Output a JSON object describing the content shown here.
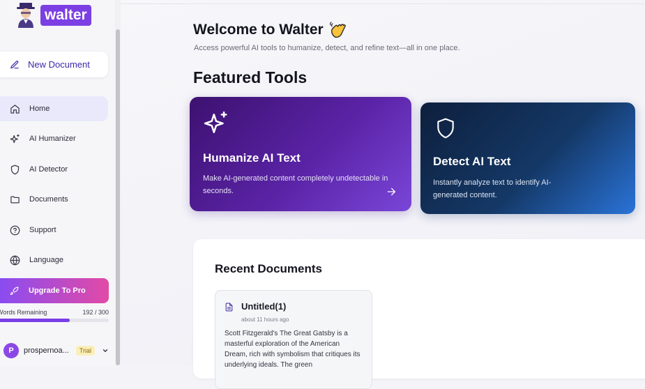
{
  "app": {
    "name": "walter"
  },
  "sidebar": {
    "new_document_label": "New Document",
    "items": [
      {
        "label": "Home",
        "icon": "home-icon",
        "active": true
      },
      {
        "label": "AI Humanizer",
        "icon": "sparkles-icon",
        "active": false
      },
      {
        "label": "AI Detector",
        "icon": "shield-icon",
        "active": false
      },
      {
        "label": "Documents",
        "icon": "folder-icon",
        "active": false
      },
      {
        "label": "Support",
        "icon": "help-circle-icon",
        "active": false
      },
      {
        "label": "Language",
        "icon": "globe-icon",
        "active": false
      }
    ],
    "upgrade_label": "Upgrade To Pro",
    "words_remaining_label": "Words Remaining",
    "words_remaining_count": "192 / 300",
    "words_remaining_fraction": 0.64,
    "user": {
      "initial": "P",
      "name": "prospernoa...",
      "plan_badge": "Trial"
    }
  },
  "main": {
    "welcome_title": "Welcome to Walter",
    "welcome_emoji": "waving-hand-icon",
    "subtitle": "Access powerful AI tools to humanize, detect, and refine text—all in one place.",
    "featured_title": "Featured Tools",
    "tools": [
      {
        "title": "Humanize AI Text",
        "description": "Make AI-generated content completely undetectable in seconds.",
        "icon": "sparkles-icon"
      },
      {
        "title": "Detect AI Text",
        "description": "Instantly analyze text to identify AI-generated content.",
        "icon": "shield-icon"
      }
    ],
    "recent_title": "Recent Documents",
    "documents": [
      {
        "title": "Untitled(1)",
        "time": "about 11 hours ago",
        "excerpt": "Scott Fitzgerald's The Great Gatsby is a masterful exploration of the American Dream, rich with symbolism that critiques its underlying ideals. The green"
      }
    ]
  },
  "colors": {
    "accent": "#7b3fe4",
    "upgrade_start": "#8a4cf0",
    "upgrade_end": "#e24aa6",
    "trial_badge": "#fbefb9"
  }
}
